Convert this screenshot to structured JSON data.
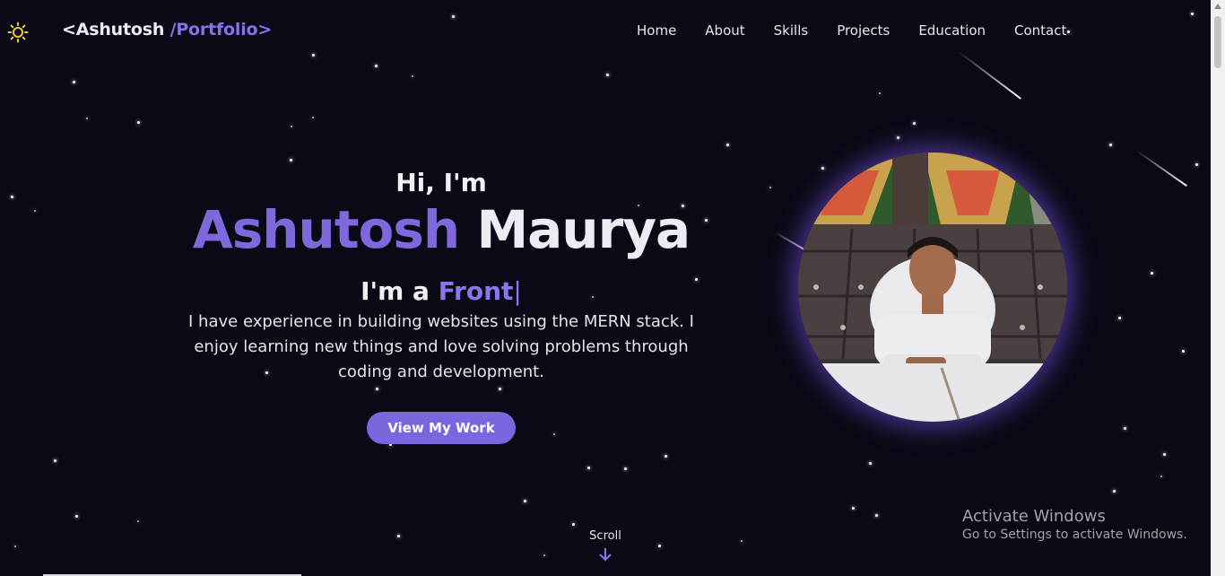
{
  "header": {
    "logo": {
      "open": "<Ashutosh",
      "accent": " /Portfolio>"
    },
    "nav": [
      "Home",
      "About",
      "Skills",
      "Projects",
      "Education",
      "Contact"
    ]
  },
  "hero": {
    "greeting": "Hi, I'm",
    "first_name": "Ashutosh",
    "last_name": "Maurya",
    "typing_prefix": "I'm a ",
    "typing_text": "Front",
    "caret": "|",
    "description": "I have experience in building websites using the MERN stack. I enjoy learning new things and love solving problems through coding and development.",
    "cta_label": "View My Work"
  },
  "scroll": {
    "label": "Scroll"
  },
  "windows_watermark": {
    "title": "Activate Windows",
    "subtitle": "Go to Settings to activate Windows."
  },
  "icons": {
    "theme_toggle": "sun-icon",
    "scroll": "arrow-down-icon"
  },
  "colors": {
    "background": "#0a0a16",
    "accent": "#7f68db",
    "button": "#7a66de",
    "glow": "#7850e6"
  }
}
